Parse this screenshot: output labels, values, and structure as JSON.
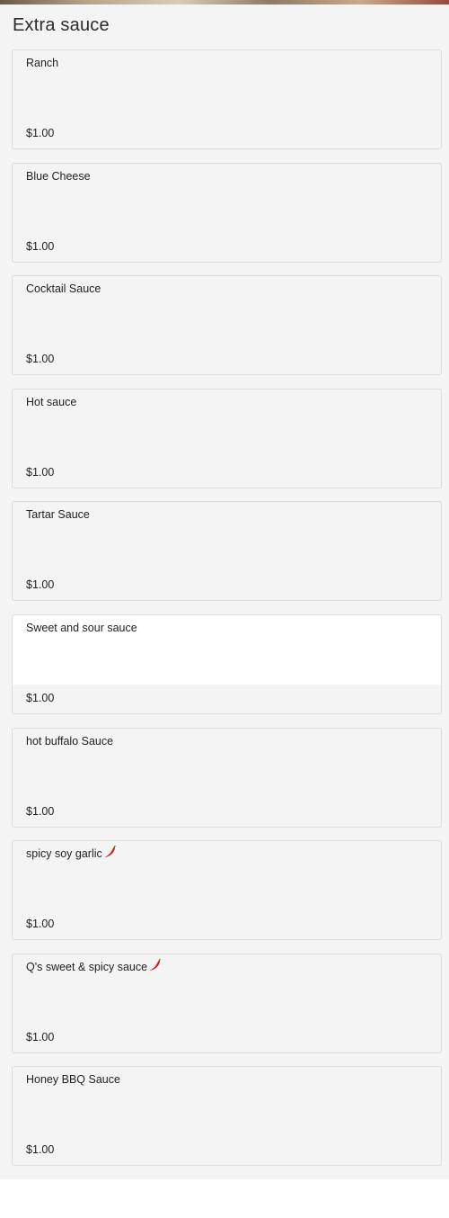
{
  "section": {
    "title": "Extra sauce",
    "items": [
      {
        "name": "Ranch",
        "price": "$1.00",
        "spicy": false
      },
      {
        "name": "Blue Cheese",
        "price": "$1.00",
        "spicy": false
      },
      {
        "name": "Cocktail Sauce",
        "price": "$1.00",
        "spicy": false
      },
      {
        "name": "Hot sauce",
        "price": "$1.00",
        "spicy": false
      },
      {
        "name": "Tartar Sauce",
        "price": "$1.00",
        "spicy": false
      },
      {
        "name": "Sweet and sour sauce",
        "price": "$1.00",
        "spicy": false,
        "highlighted": true
      },
      {
        "name": "hot buffalo Sauce",
        "price": "$1.00",
        "spicy": false
      },
      {
        "name": "spicy soy garlic",
        "price": "$1.00",
        "spicy": true
      },
      {
        "name": "Q's sweet & spicy sauce",
        "price": "$1.00",
        "spicy": true
      },
      {
        "name": "Honey BBQ Sauce",
        "price": "$1.00",
        "spicy": false
      }
    ]
  },
  "icons": {
    "spicy": "chili-pepper-icon"
  },
  "colors": {
    "section_bg": "#f4f4f4",
    "card_border": "#dcdcdc",
    "highlight_bg": "#ffffff",
    "chili": "#d31a1a"
  }
}
